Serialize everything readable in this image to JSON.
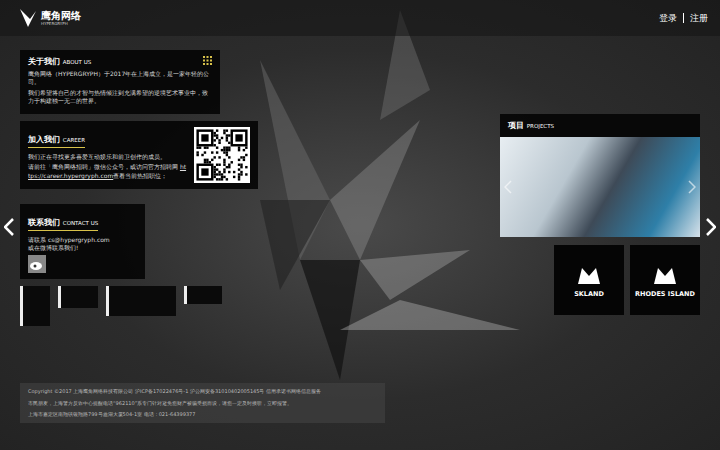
{
  "header": {
    "logo": "鹰角网络",
    "logo_sub": "HYPERGRYPH",
    "links": [
      {
        "label": "登录"
      },
      {
        "label": "注册"
      }
    ]
  },
  "about": {
    "title": "关于我们",
    "subtitle": "ABOUT US",
    "paragraphs": [
      "鹰角网络（HYPERGRYPH）于2017年在上海成立，是一家年轻的公司。",
      "我们希望将自己的才智与热情倾注到充满希望的逆境艺术事业中，致力于构建独一无二的世界。"
    ]
  },
  "career": {
    "title": "加入我们",
    "subtitle": "CAREER",
    "paragraphs": [
      "我们正在寻找更多喜爱互动娱乐和前卫创作的成员。",
      "请前往「鹰角网络招聘」微信公众号，或访问官方招聘网"
    ],
    "link": "https://career.hypergryph.com",
    "link_after": "查看当前热招职位；"
  },
  "contact": {
    "title": "联系我们",
    "subtitle": "CONTACT US",
    "lines": [
      "请联系 cs@hypergryph.com",
      "或在微博联系我们!"
    ]
  },
  "projects": {
    "title": "项目",
    "subtitle": "PROJECTS",
    "tiles": [
      {
        "label": "SKLAND"
      },
      {
        "label": "RHODES ISLAND"
      }
    ]
  },
  "thumbnails": [
    {
      "selected": false
    },
    {
      "selected": false
    },
    {
      "selected": false
    },
    {
      "selected": false
    }
  ],
  "footer": {
    "lines": [
      "Copyright ©2017 上海鹰角网络科技有限公司 沪ICP备17022476号-1  沪公网安备31010402005145号  信用承诺书网络信息服务",
      "市民朋友，上海警方反诈中心提醒电话“962110”系专门针对避免您财产被骗受损而设，请您一定及时接听，立即报警。",
      "上海市嘉定区南翔镇银翔路799号鑫湖大厦504-1室 电话：021-64399377"
    ]
  }
}
